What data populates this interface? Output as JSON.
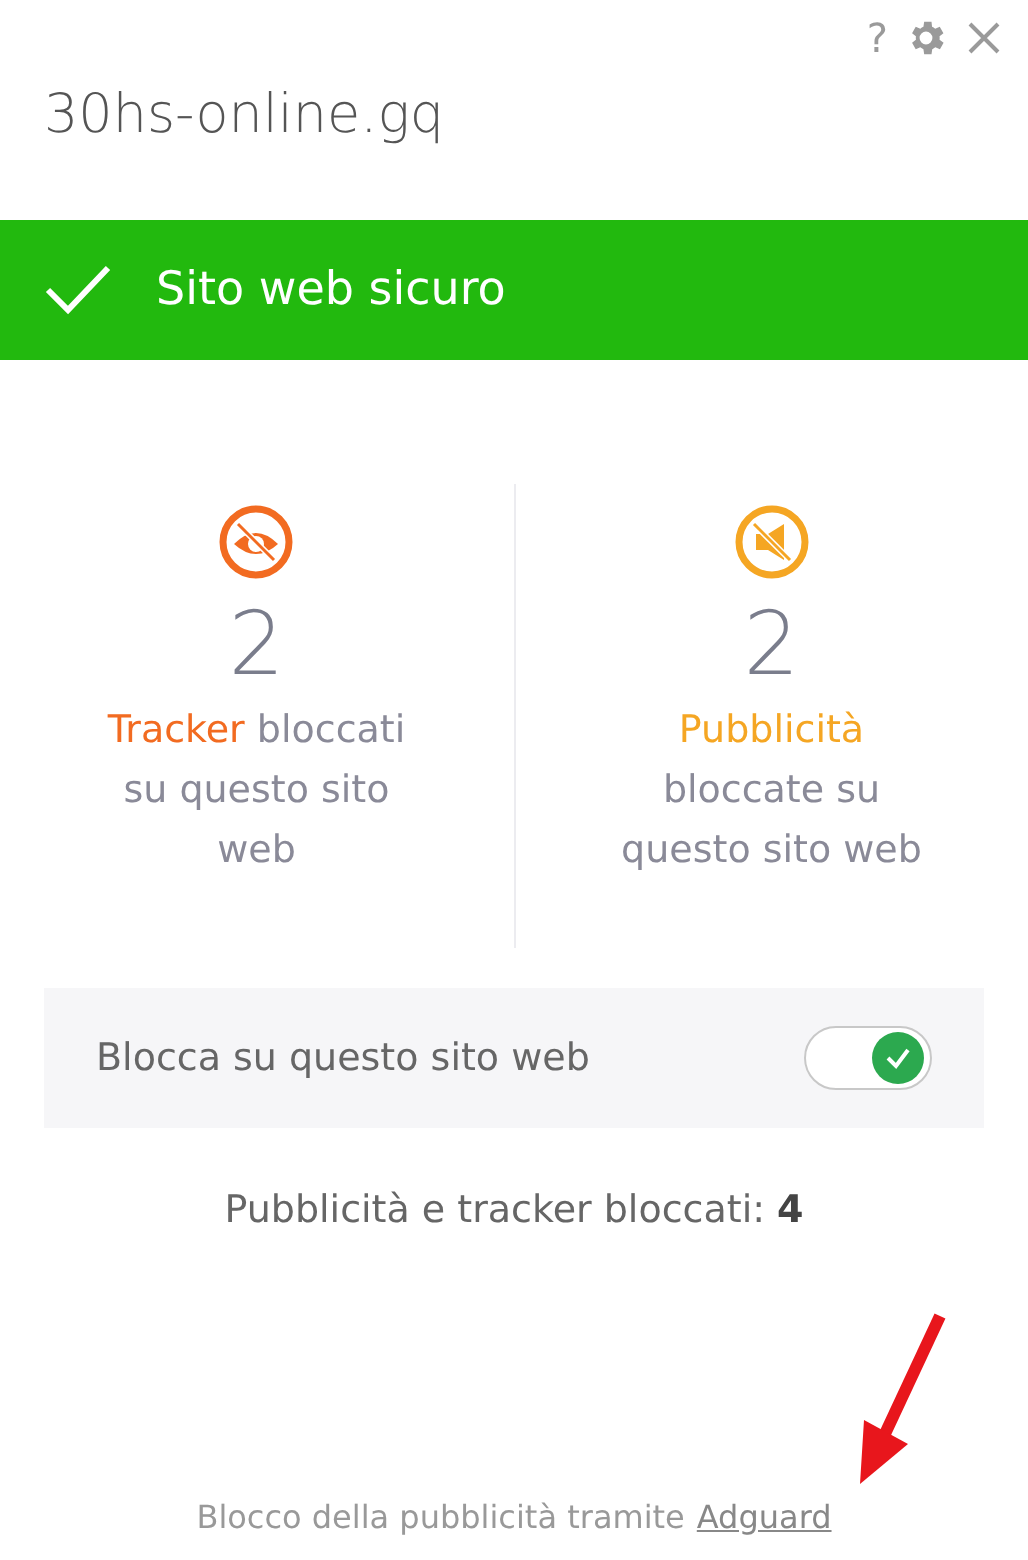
{
  "header": {
    "buttons": [
      {
        "kind": "help",
        "label": "?"
      },
      {
        "kind": "settings"
      },
      {
        "kind": "close"
      }
    ],
    "domain": "30hs-online.gq"
  },
  "status": {
    "kind": "safe",
    "label": "Sito web sicuro"
  },
  "stats": [
    {
      "kind": "tracker",
      "count": "2",
      "highlight": "Tracker",
      "text": "bloccati su questo sito web",
      "color": "#f26b21"
    },
    {
      "kind": "ads",
      "count": "2",
      "highlight": "Pubblicità",
      "text": "bloccate su questo sito web",
      "color": "#f5a623"
    }
  ],
  "block_toggle": {
    "label": "Blocca su questo sito web",
    "on": true
  },
  "total": "Pubblicità e tracker bloccati: **4**",
  "footer": {
    "text": "Blocco della pubblicità tramite",
    "link": "Adguard"
  },
  "annotation": {
    "kind": "arrow"
  }
}
